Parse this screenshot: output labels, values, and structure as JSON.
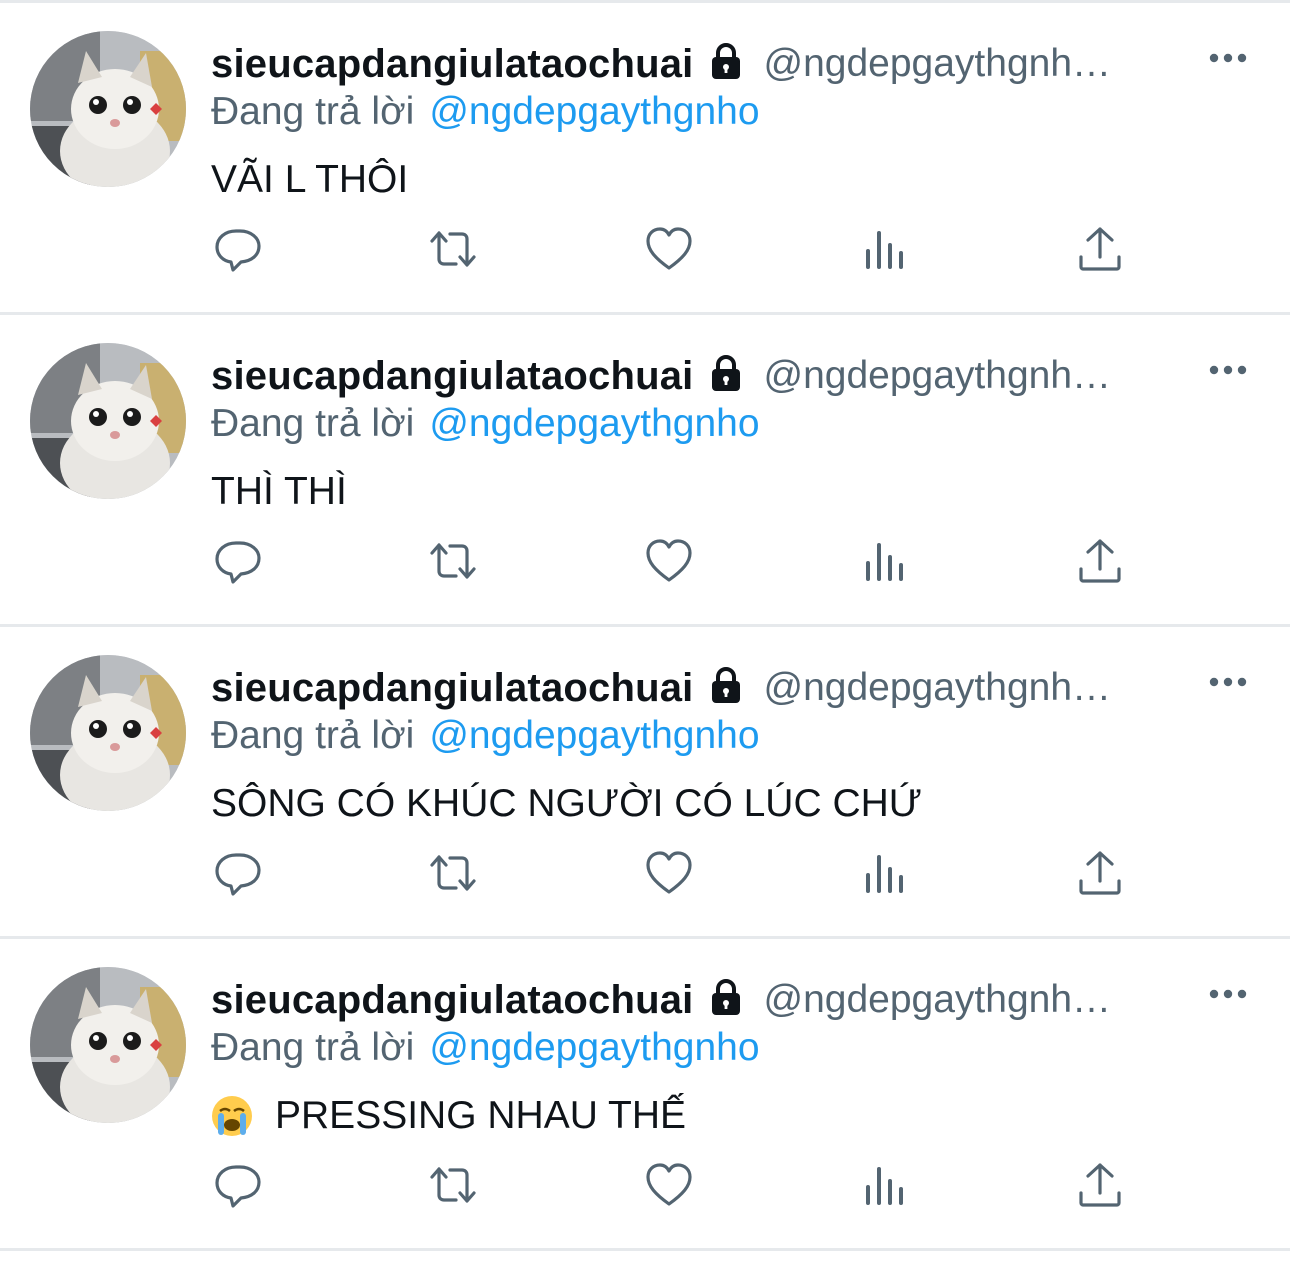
{
  "tweets": [
    {
      "display_name": "sieucapdangiulataochuai",
      "handle": "@ngdepgaythgnh…",
      "reply_prefix": "Đang trả lời",
      "reply_target": "@ngdepgaythgnho",
      "text": "VÃI L THÔI",
      "has_emoji": false
    },
    {
      "display_name": "sieucapdangiulataochuai",
      "handle": "@ngdepgaythgnh…",
      "reply_prefix": "Đang trả lời",
      "reply_target": "@ngdepgaythgnho",
      "text": "THÌ THÌ",
      "has_emoji": false
    },
    {
      "display_name": "sieucapdangiulataochuai",
      "handle": "@ngdepgaythgnh…",
      "reply_prefix": "Đang trả lời",
      "reply_target": "@ngdepgaythgnho",
      "text": "SÔNG CÓ KHÚC NGƯỜI CÓ LÚC CHỨ",
      "has_emoji": false
    },
    {
      "display_name": "sieucapdangiulataochuai",
      "handle": "@ngdepgaythgnh…",
      "reply_prefix": "Đang trả lời",
      "reply_target": "@ngdepgaythgnho",
      "text": "PRESSING NHAU THẾ",
      "has_emoji": true,
      "emoji_name": "loudly-crying-face-icon"
    }
  ],
  "action_icons": [
    "reply-icon",
    "retweet-icon",
    "like-icon",
    "views-icon",
    "share-icon"
  ],
  "colors": {
    "name": "#0f1419",
    "secondary": "#536471",
    "link": "#1d9bf0",
    "separator": "#e6e9ec",
    "icon": "#536471"
  }
}
